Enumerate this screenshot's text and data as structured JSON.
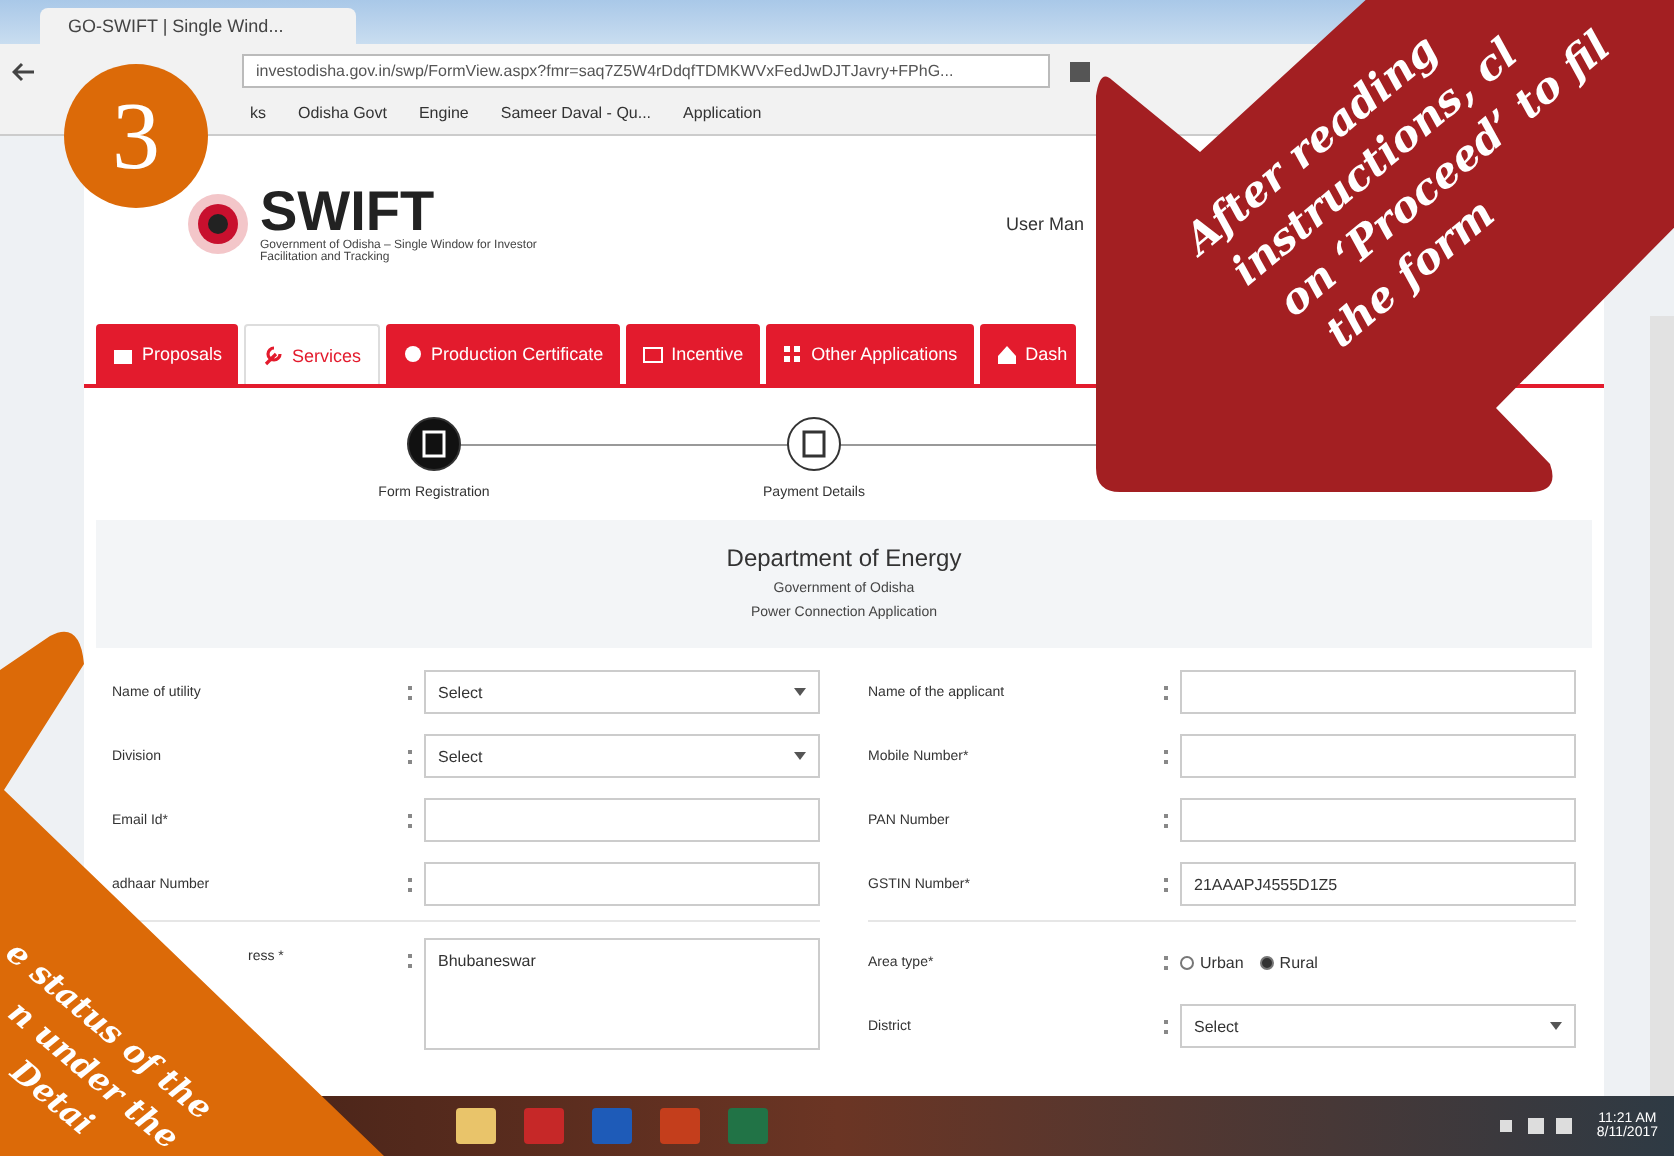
{
  "browser": {
    "tab_title": "GO-SWIFT | Single Wind...",
    "url": "investodisha.gov.in/swp/FormView.aspx?fmr=saq7Z5W4rDdqfTDMKWVxFedJwDJTJavry+FPhG...",
    "bookmarks": [
      {
        "label": "ks"
      },
      {
        "label": "Odisha Govt"
      },
      {
        "label": "Engine"
      },
      {
        "label": "Sameer Daval - Qu..."
      },
      {
        "label": "Application"
      }
    ]
  },
  "header": {
    "logo_text": "SWIFT",
    "tagline": "Government of Odisha – Single Window for Investor Facilitation and Tracking",
    "user_manual": "User Man"
  },
  "tabs": [
    {
      "label": "Proposals",
      "selected": false
    },
    {
      "label": "Services",
      "selected": true
    },
    {
      "label": "Production Certificate",
      "selected": false
    },
    {
      "label": "Incentive",
      "selected": false
    },
    {
      "label": "Other Applications",
      "selected": false
    },
    {
      "label": "Dash",
      "selected": false
    }
  ],
  "steps": [
    {
      "label": "Form Registration",
      "active": true
    },
    {
      "label": "Payment Details",
      "active": false
    }
  ],
  "form": {
    "title": "Department of Energy",
    "subtitle": "Government of Odisha",
    "form_name": "Power Connection Application",
    "left": [
      {
        "label": "Name of utility",
        "kind": "select",
        "value": "Select"
      },
      {
        "label": "Division",
        "kind": "select",
        "value": "Select"
      },
      {
        "label": "Email Id*",
        "kind": "text"
      },
      {
        "label": "adhaar Number",
        "kind": "text"
      }
    ],
    "right": [
      {
        "label": "Name of the applicant",
        "kind": "text"
      },
      {
        "label": "Mobile Number*",
        "kind": "text"
      },
      {
        "label": "PAN Number",
        "kind": "text"
      },
      {
        "label": "GSTIN Number*",
        "kind": "text",
        "value": "21AAAPJ4555D1Z5"
      }
    ],
    "left2": [
      {
        "label": "ress *",
        "kind": "textarea",
        "value": "Bhubaneswar"
      }
    ],
    "right2": [
      {
        "label": "Area type*",
        "kind": "radio",
        "options": [
          {
            "label": "Urban",
            "selected": false
          },
          {
            "label": "Rural",
            "selected": true
          }
        ]
      },
      {
        "label": "District",
        "kind": "select",
        "value": "Select"
      }
    ]
  },
  "taskbar": {
    "time": "11:21 AM",
    "date": "8/11/2017"
  },
  "badge": {
    "number": "3"
  },
  "callouts": [
    {
      "kind": "red",
      "lines": [
        "After reading",
        "instructions, cl",
        "on ‘Proceed’ to fil",
        "the form"
      ]
    },
    {
      "kind": "orange",
      "lines": [
        "e status of the",
        "n under the",
        "Detai"
      ]
    }
  ]
}
